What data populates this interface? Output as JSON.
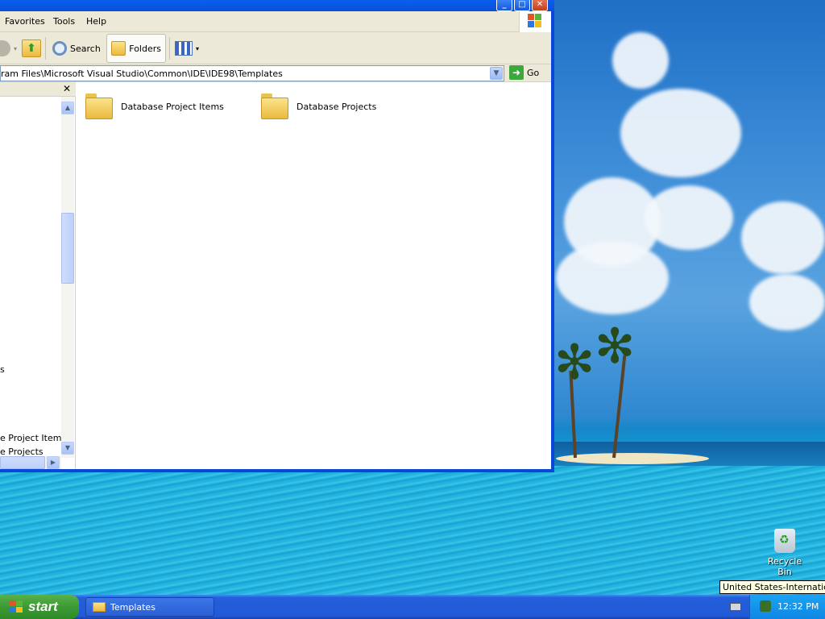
{
  "window": {
    "menu": [
      "Favorites",
      "Tools",
      "Help"
    ],
    "toolbar": {
      "search_label": "Search",
      "folders_label": "Folders"
    },
    "address": {
      "path": "ram Files\\Microsoft Visual Studio\\Common\\IDE\\IDE98\\Templates",
      "go_label": "Go"
    },
    "tree": {
      "items": [
        "s",
        "e Project Items",
        "e Projects"
      ]
    },
    "content": {
      "folders": [
        "Database Project Items",
        "Database Projects"
      ]
    }
  },
  "desktop": {
    "recycle_bin_label": "Recycle Bin"
  },
  "taskbar": {
    "start_label": "start",
    "task_item_label": "Templates",
    "clock": "12:32 PM",
    "tooltip": "United States-International"
  },
  "colors": {
    "titlebar": "#0a5ff0",
    "taskbar": "#245edb",
    "start": "#3c9a34",
    "tray": "#0f86e4"
  }
}
